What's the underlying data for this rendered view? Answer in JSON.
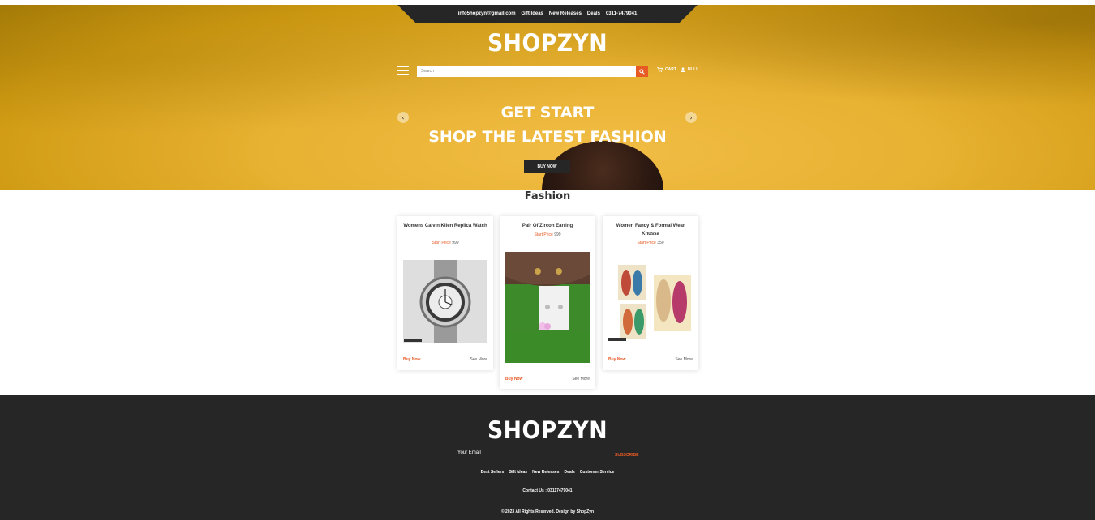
{
  "brand": {
    "logo": "SHOPZYN"
  },
  "topbar": {
    "email": "info5hopzyn@gmail.com",
    "links": [
      "Gift Ideas",
      "New Releases",
      "Deals"
    ],
    "phone": "0311-7479041"
  },
  "search": {
    "placeholder": "Search"
  },
  "header": {
    "cart_label": "CART",
    "user_label": "NULL"
  },
  "hero": {
    "line1": "GET START",
    "line2": "SHOP THE LATEST FASHION",
    "button": "BUY NOW",
    "prev_icon": "chevron-left-icon",
    "next_icon": "chevron-right-icon"
  },
  "fashion": {
    "title": "Fashion",
    "products": [
      {
        "title": "Womens Calvin Klien Replica Watch",
        "price_label": "Start Price",
        "price": "999",
        "buy": "Buy Now",
        "more": "See More"
      },
      {
        "title": "Pair Of Zircon Earring",
        "price_label": "Start Price",
        "price": "999",
        "buy": "Buy Now",
        "more": "See More"
      },
      {
        "title": "Women Fancy & Formal Wear Khussa",
        "price_label": "Start Price",
        "price": "350",
        "buy": "Buy Now",
        "more": "See More"
      }
    ]
  },
  "footer": {
    "logo": "SHOPZYN",
    "email_label": "Your Email",
    "subscribe": "SUBSCRIBE",
    "links": [
      "Best Sellers",
      "Gift Ideas",
      "New Releases",
      "Deals",
      "Customer Service"
    ],
    "contact": "Contact Us : 03117479041",
    "copyright": "© 2023 All Rights Reserved. Design by ShopZyn"
  },
  "colors": {
    "accent": "#e85a24",
    "dark": "#262626",
    "hero_yellow": "#e7b131"
  }
}
